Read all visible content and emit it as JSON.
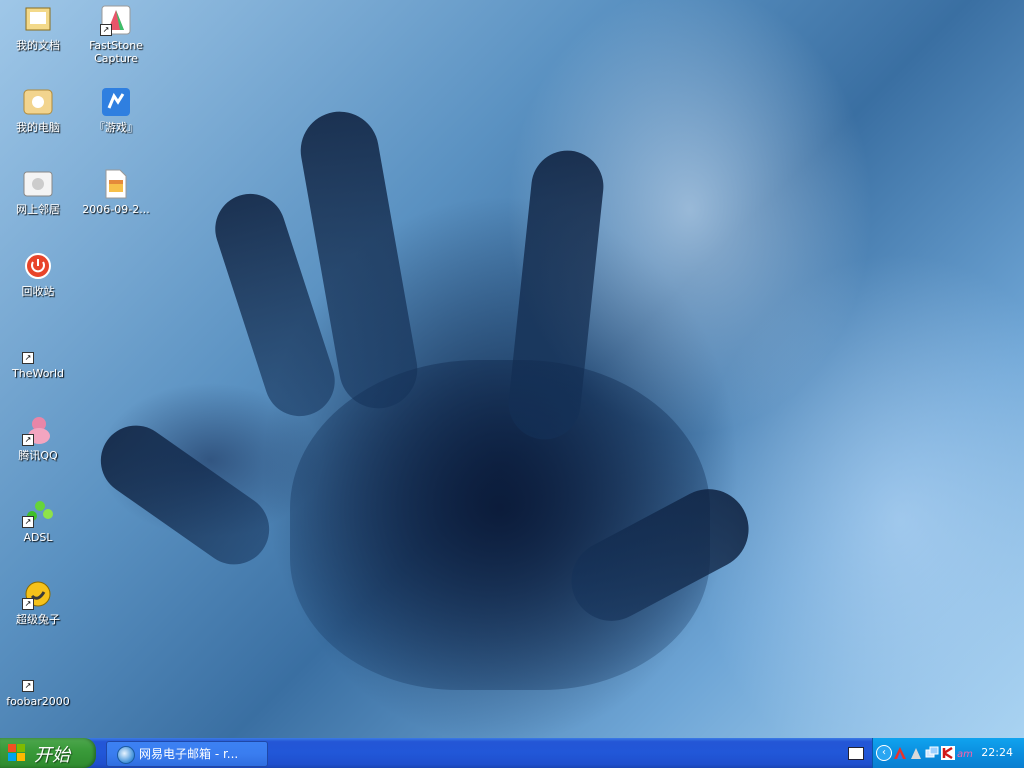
{
  "desktop": {
    "icons": [
      {
        "label": "我的文档",
        "icon": "my-documents-icon"
      },
      {
        "label": "FastStone Capture",
        "icon": "faststone-capture-icon"
      },
      {
        "label": "我的电脑",
        "icon": "my-computer-icon"
      },
      {
        "label": "『游戏』",
        "icon": "games-folder-icon"
      },
      {
        "label": "网上邻居",
        "icon": "network-places-icon"
      },
      {
        "label": "2006-09-2...",
        "icon": "file-icon"
      },
      {
        "label": "回收站",
        "icon": "recycle-bin-icon"
      },
      {
        "label": "TheWorld",
        "icon": "theworld-browser-icon"
      },
      {
        "label": "腾讯QQ",
        "icon": "qq-icon"
      },
      {
        "label": "ADSL",
        "icon": "adsl-icon"
      },
      {
        "label": "超级兔子",
        "icon": "super-rabbit-icon"
      },
      {
        "label": "foobar2000",
        "icon": "foobar2000-icon"
      }
    ]
  },
  "taskbar": {
    "start_label": "开始",
    "task_item": "网易电子邮箱 - r...",
    "clock": "22:24"
  },
  "colors": {
    "taskbar": "#2157d8",
    "start": "#3a9b3a",
    "tray": "#0b8fe0"
  }
}
